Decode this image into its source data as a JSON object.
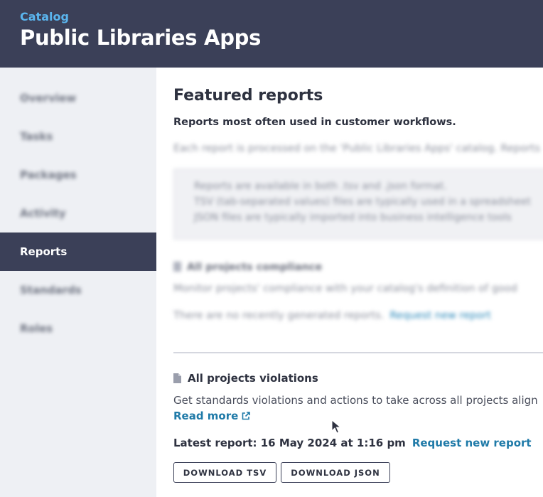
{
  "header": {
    "breadcrumb": "Catalog",
    "title": "Public Libraries Apps"
  },
  "sidebar": {
    "items": [
      {
        "label": "Overview",
        "blurred": true
      },
      {
        "label": "Tasks",
        "blurred": true
      },
      {
        "label": "Packages",
        "blurred": true
      },
      {
        "label": "Activity",
        "blurred": true
      },
      {
        "label": "Reports",
        "active": true
      },
      {
        "label": "Standards",
        "blurred": true
      },
      {
        "label": "Roles",
        "blurred": true
      }
    ]
  },
  "main": {
    "heading": "Featured reports",
    "subheading": "Reports most often used in customer workflows.",
    "intro": "Each report is processed on the 'Public Libraries Apps' catalog. Reports",
    "info_lines": [
      "Reports are available in both .tsv and .json format.",
      "TSV (tab-separated values) files are typically used in a spreadsheet",
      "JSON files are typically imported into business intelligence tools"
    ],
    "report_compliance": {
      "title": "All projects compliance",
      "description": "Monitor projects' compliance with your catalog's definition of good",
      "empty_text": "There are no recently generated reports.",
      "request_link": "Request new report"
    },
    "report_violations": {
      "title": "All projects violations",
      "description": "Get standards violations and actions to take across all projects align",
      "read_more": "Read more",
      "latest_label": "Latest report: 16 May 2024 at 1:16 pm",
      "request_link": "Request new report",
      "download_tsv": "DOWNLOAD TSV",
      "download_json": "DOWNLOAD JSON"
    }
  },
  "colors": {
    "header_bg": "#3b4058",
    "accent_link": "#1f7aa8",
    "breadcrumb": "#5ab5ee",
    "sidebar_bg": "#eef0f4"
  }
}
